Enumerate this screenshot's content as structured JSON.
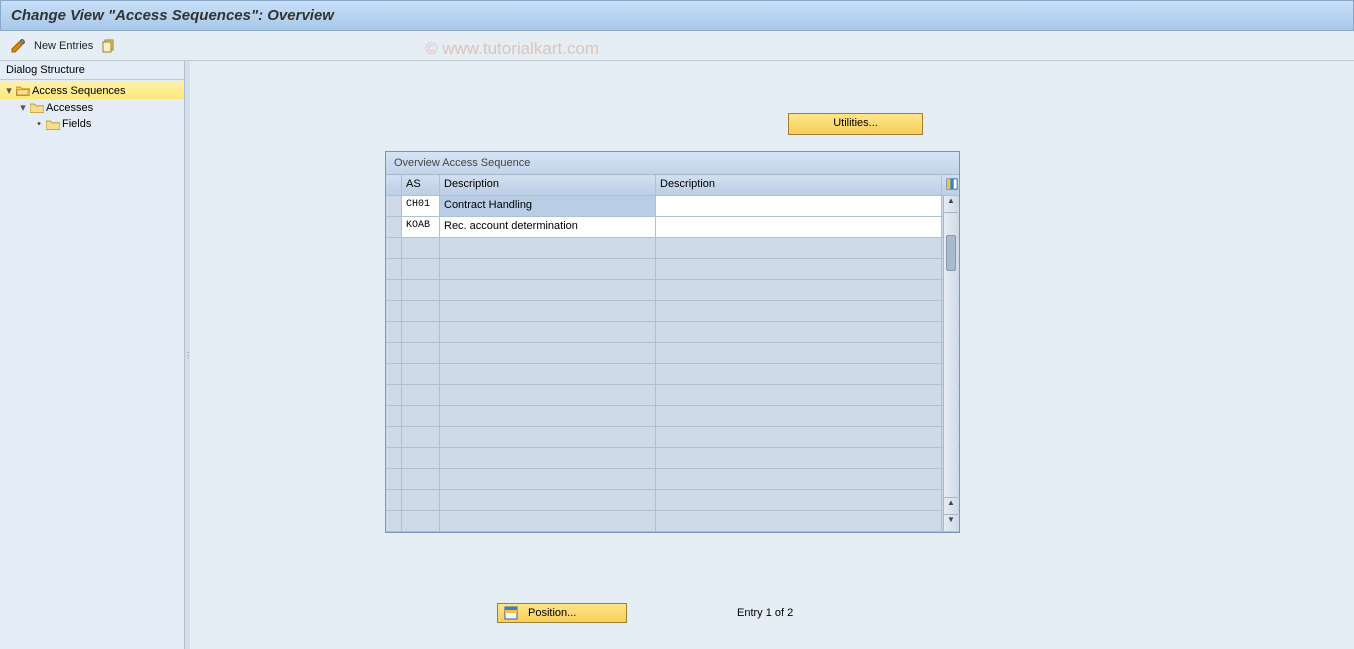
{
  "header": {
    "title": "Change View \"Access Sequences\": Overview"
  },
  "toolbar": {
    "new_entries": "New Entries"
  },
  "watermark": "© www.tutorialkart.com",
  "sidebar": {
    "title": "Dialog Structure",
    "items": [
      {
        "label": "Access Sequences",
        "level": 0,
        "selected": true,
        "open": true
      },
      {
        "label": "Accesses",
        "level": 1,
        "selected": false,
        "open": true
      },
      {
        "label": "Fields",
        "level": 2,
        "selected": false
      }
    ]
  },
  "buttons": {
    "utilities": "Utilities...",
    "position": "Position..."
  },
  "table": {
    "title": "Overview Access Sequence",
    "columns": {
      "as": "AS",
      "desc1": "Description",
      "desc2": "Description"
    },
    "rows": [
      {
        "as": "CH01",
        "desc1": "Contract Handling",
        "desc2": "",
        "highlight": true
      },
      {
        "as": "KOAB",
        "desc1": "Rec. account determination",
        "desc2": ""
      }
    ]
  },
  "footer": {
    "entry": "Entry 1 of 2"
  }
}
